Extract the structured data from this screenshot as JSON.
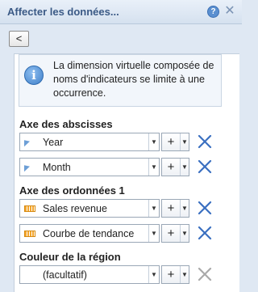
{
  "window": {
    "title": "Affecter les données...",
    "help_glyph": "?",
    "close_glyph": "✕"
  },
  "back_button": {
    "label": "<"
  },
  "info": {
    "icon": "info-icon",
    "glyph": "i",
    "text": "La dimension virtuelle composée de noms d'indicateurs se limite à une occurrence."
  },
  "sections": {
    "x_axis": {
      "title": "Axe des abscisses",
      "fields": [
        {
          "value": "Year",
          "icon": "dimension-icon"
        },
        {
          "value": "Month",
          "icon": "dimension-icon"
        }
      ]
    },
    "y_axis": {
      "title": "Axe des ordonnées 1",
      "fields": [
        {
          "value": "Sales revenue",
          "icon": "measure-icon"
        },
        {
          "value": "Courbe de tendance",
          "icon": "measure-icon"
        }
      ]
    },
    "region_color": {
      "title": "Couleur de la région",
      "fields": [
        {
          "value": "(facultatif)",
          "icon": ""
        }
      ]
    }
  },
  "controls": {
    "plus": "+",
    "dropdown": "▼"
  },
  "colors": {
    "title_text": "#3b5a86",
    "remove_active": "#3a6fc0",
    "remove_disabled": "#a9a9a9"
  }
}
